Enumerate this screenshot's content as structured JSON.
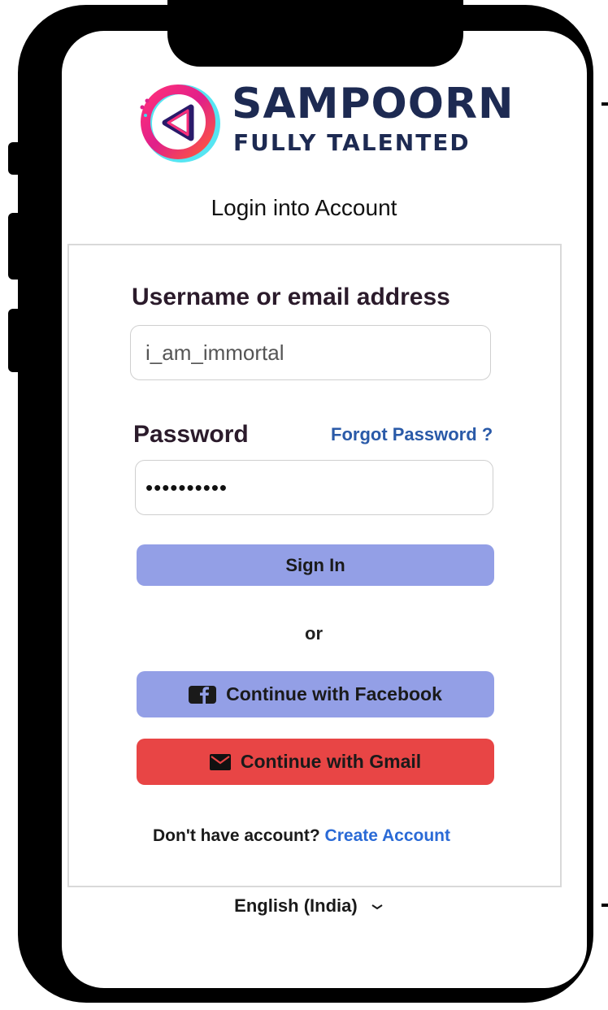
{
  "brand": {
    "name": "SAMPOORN",
    "tagline": "FULLY TALENTED"
  },
  "page": {
    "heading": "Login into Account"
  },
  "form": {
    "username_label": "Username or email address",
    "username_value": "i_am_immortal",
    "password_label": "Password",
    "forgot_label": "Forgot Password ?",
    "password_value": "••••••••••",
    "signin_label": "Sign In",
    "or_label": "or",
    "facebook_label": "Continue with Facebook",
    "gmail_label": "Continue with Gmail"
  },
  "footer": {
    "no_account_text": "Don't have account?",
    "create_account_label": "Create Account",
    "language": "English (India)"
  },
  "icons": {
    "logo": "play-triangle-logo-icon",
    "facebook": "facebook-icon",
    "gmail": "envelope-icon",
    "language": "chevron-down-icon"
  },
  "colors": {
    "primary_button": "#939fe6",
    "gmail_button": "#e84545",
    "link": "#2a6ad6",
    "brand_text": "#1d2a52"
  }
}
